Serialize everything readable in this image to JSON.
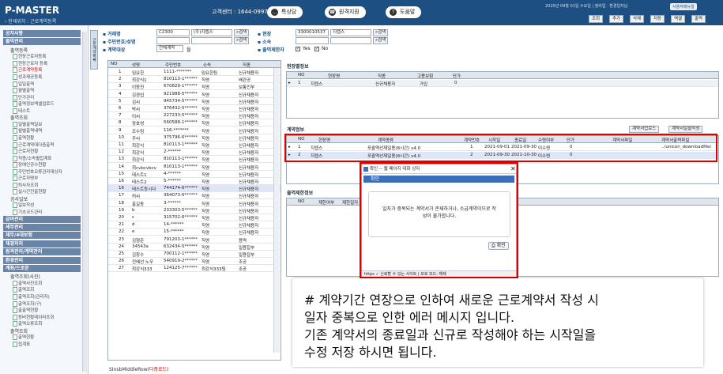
{
  "header": {
    "logo": "P-MASTER",
    "breadcrumb": "› 현재위치 : 근로계약등록",
    "call_center": "고객센터 : 1644-0997",
    "buttons": [
      "특상담",
      "원격지원",
      "도움말"
    ],
    "info": "2020년 09월 01일 수요일 | 정비업 · 환경업자님",
    "help_link": "사용자매뉴얼",
    "toolbar": [
      "조회",
      "추가",
      "삭제",
      "저장",
      "엑셀",
      "출력"
    ]
  },
  "sidebar": {
    "items": [
      {
        "type": "sec",
        "label": "공지사항"
      },
      {
        "type": "sec",
        "label": "출역관리"
      },
      {
        "type": "sub",
        "label": "출역등록"
      },
      {
        "type": "leaf",
        "label": "현장근로자등록"
      },
      {
        "type": "leaf",
        "label": "현장근로자 등록"
      },
      {
        "type": "leaf",
        "label": "근로계약등록",
        "selected": true
      },
      {
        "type": "leaf",
        "label": "성과제공등록"
      },
      {
        "type": "leaf",
        "label": "일일출역"
      },
      {
        "type": "leaf",
        "label": "월별출역"
      },
      {
        "type": "leaf",
        "label": "단가관리"
      },
      {
        "type": "leaf",
        "label": "출역정보엑셀업로드"
      },
      {
        "type": "leaf",
        "label": "테스트"
      },
      {
        "type": "sub",
        "label": "출역조회"
      },
      {
        "type": "leaf",
        "label": "일별출역일보"
      },
      {
        "type": "leaf",
        "label": "월별출역내역"
      },
      {
        "type": "leaf",
        "label": "출역현황"
      },
      {
        "type": "leaf",
        "label": "근로계약대다중출력"
      },
      {
        "type": "leaf",
        "label": "근로자현황"
      },
      {
        "type": "leaf",
        "label": "직종/소속별집계표"
      },
      {
        "type": "leaf",
        "label": "장애인공수현황"
      },
      {
        "type": "leaf",
        "label": "주민번호오류관리대상자"
      },
      {
        "type": "leaf",
        "label": "근로자명부"
      },
      {
        "type": "leaf",
        "label": "퇴사자조회"
      },
      {
        "type": "leaf",
        "label": "실시간전출현황"
      },
      {
        "type": "sub",
        "label": "공사일보"
      },
      {
        "type": "leaf",
        "label": "일보작성"
      },
      {
        "type": "leaf",
        "label": "기초코드관리"
      },
      {
        "type": "sec",
        "label": "급여관리"
      },
      {
        "type": "sec",
        "label": "세무관리"
      },
      {
        "type": "sec",
        "label": "재무/4대보험"
      },
      {
        "type": "sec",
        "label": "재경처리"
      },
      {
        "type": "sec",
        "label": "원격관리/계약관리"
      },
      {
        "type": "sec",
        "label": "환경관리"
      },
      {
        "type": "sec",
        "label": "계좌/드로운"
      },
      {
        "type": "sub",
        "label": "출역조회(사진)"
      },
      {
        "type": "leaf",
        "label": "출역사진조회"
      },
      {
        "type": "leaf",
        "label": "출역조회"
      },
      {
        "type": "leaf",
        "label": "출역조회(관리자)"
      },
      {
        "type": "leaf",
        "label": "출역조회(구)"
      },
      {
        "type": "leaf",
        "label": "출출역현황"
      },
      {
        "type": "leaf",
        "label": "장비현황데이터조회"
      },
      {
        "type": "leaf",
        "label": "출역오류조회"
      },
      {
        "type": "sub",
        "label": "출역조회"
      },
      {
        "type": "leaf",
        "label": "출역현황"
      },
      {
        "type": "leaf",
        "label": "집계표"
      }
    ]
  },
  "side_tab": "근로계약목록",
  "filter": {
    "company_label": "거래명",
    "company_code": "C2300",
    "company_name": "(주)지렙스",
    "site_label": "현장",
    "site_code": "3300010537",
    "site_name": "지렙스",
    "id_label": "주민번호/성명",
    "affil_label": "소속",
    "contract_label": "계약대상",
    "contract_value": "전체계약",
    "contract_unit": "월",
    "active_label": "출역제한자",
    "yes_label": "Yes",
    "no_label": "No",
    "search_label": "검색"
  },
  "employees": {
    "columns": [
      "NO",
      "성명",
      "주민번호",
      "소속",
      "직종"
    ],
    "rows": [
      [
        "1",
        "임요한",
        "1111-*******",
        "임요한팀",
        "신규채용자"
      ],
      [
        "2",
        "최강식1",
        "810113-1******",
        "직영",
        "배관공"
      ],
      [
        "3",
        "이동진",
        "670829-1******",
        "직영",
        "보통인부"
      ],
      [
        "4",
        "김경섭",
        "921988-5******",
        "직영",
        "신규채용자"
      ],
      [
        "5",
        "김씨",
        "945734-5******",
        "직영",
        "신규채용자"
      ],
      [
        "6",
        "박씨",
        "376432-5******",
        "직영",
        "신규채용자"
      ],
      [
        "7",
        "이씨",
        "227233-5******",
        "직영",
        "신규채용자"
      ],
      [
        "8",
        "장호영",
        "560588-1******",
        "직영",
        "신규채용자"
      ],
      [
        "9",
        "조수림",
        "116-*******",
        "직영",
        "신규채용자"
      ],
      [
        "10",
        "주씨",
        "375796-6******",
        "직영",
        "신규채용자"
      ],
      [
        "11",
        "최강식",
        "810113-1******",
        "직영",
        "신규채용자"
      ],
      [
        "12",
        "최강식",
        "2-******",
        "직영",
        "신규채용자"
      ],
      [
        "13",
        "최강식",
        "810113-1******",
        "직영",
        "신규채용자"
      ],
      [
        "14",
        "최cvbcvbcv",
        "810113-1******",
        "직영",
        "신규채용자"
      ],
      [
        "15",
        "테스트1",
        "4-******",
        "직영",
        "신규채용자"
      ],
      [
        "16",
        "테스트2",
        "5-******",
        "직영",
        "신규채용자"
      ],
      [
        "16",
        "테스트등시다",
        "744174-6******",
        "직영",
        "신규채용자"
      ],
      [
        "17",
        "허씨",
        "364073-6******",
        "직영",
        "신규채용자"
      ],
      [
        "18",
        "홍길동",
        "3-******",
        "직영",
        "신규채용자"
      ],
      [
        "19",
        "b",
        "233303-5******",
        "직영",
        "신규채용자"
      ],
      [
        "20",
        "c",
        "315702-6******",
        "직영",
        "신규채용자"
      ],
      [
        "21",
        "d",
        "14-******",
        "직영",
        "신규채용자"
      ],
      [
        "22",
        "e",
        "15-******",
        "직영",
        "신규채용자"
      ],
      [
        "23",
        "김형준",
        "791203-1******",
        "직영",
        "용역"
      ],
      [
        "24",
        "34543a",
        "632434-5******",
        "직영",
        "일용잡부"
      ],
      [
        "25",
        "김창수",
        "700112-1******",
        "직영",
        "일용잡부"
      ],
      [
        "26",
        "전혜선 노무",
        "540919-2******",
        "직영",
        "조공"
      ],
      [
        "27",
        "최강식333",
        "124125-7******",
        "최강식333팀",
        "조공"
      ]
    ],
    "selected_index": 16
  },
  "site_info": {
    "title": "현장별정보",
    "columns": [
      "NO",
      "현장명",
      "직종",
      "고용보험",
      "단가"
    ],
    "rows": [
      [
        "1",
        "지렙스",
        "신규채용자",
        "가입",
        "0"
      ]
    ]
  },
  "contract_info": {
    "title": "계약정보",
    "btn_upload": "계약서업로드",
    "btn_write": "계약서일괄작성",
    "columns": [
      "NO",
      "현장명",
      "계약종류",
      "계약번호",
      "시작일",
      "종료일",
      "수령여부",
      "단가",
      "계약서파일",
      "계약서출력파일"
    ],
    "rows": [
      [
        "1",
        "지렙스",
        "포괄역선재일용(8시간) v4.0",
        "1",
        "2021-09-01",
        "2021-09-30",
        "미수령",
        "0",
        "",
        "../unicon_downloadfile/"
      ],
      [
        "2",
        "지렙스",
        "포괄역선재일용(8시간) v4.0",
        "2",
        "2021-09-30",
        "2021-10-30",
        "미수령",
        "0",
        "",
        ""
      ]
    ]
  },
  "restrict_info": {
    "title": "출역제한정보",
    "columns": [
      "NO",
      "제한여부",
      "제한일자"
    ]
  },
  "dialog": {
    "title": "확인 -- 웹 페이지 대화 상자",
    "bar": "확인",
    "message_1": "일자가 중복되는 계약서가 존재하거나, 소급계약이므로 작",
    "message_2": "성이 불가합니다.",
    "ok": "확인",
    "status": "https ✓ 신뢰할 수 있는 사이트 | 보호 모드: 해제"
  },
  "note": {
    "line1": "# 계약기간 연장으로 인하여 새로운 근로계약서 작성 시",
    "line2": "일자 중복으로 인한 에러 메시지 입니다.",
    "line3": "기존 계약서의 종료일과 신규로 작성해야 하는 시작일을",
    "line4": "수정 저장 하시면 됩니다."
  },
  "footer": {
    "text": "SInsbMiddleRow(",
    "red": "다중로드",
    "close": ")"
  },
  "colors": {
    "header_bg": "#1d4f82",
    "highlight": "#e00000",
    "dialog_bar": "#3a6fb8"
  }
}
